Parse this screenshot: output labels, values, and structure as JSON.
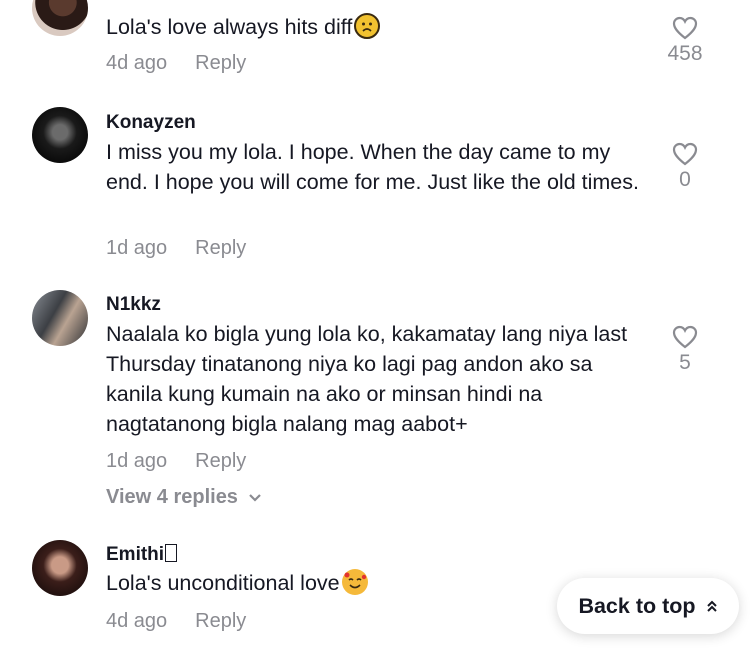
{
  "comments": [
    {
      "username": "",
      "text": "Lola's love always hits diff",
      "emoji": "sad-face-emoji",
      "time": "4d ago",
      "reply": "Reply",
      "likes": "458"
    },
    {
      "username": "Konayzen",
      "text": "I miss you my lola. I hope. When the day came to my end. I hope you will come for me. Just like the old times.",
      "time": "1d ago",
      "reply": "Reply",
      "likes": "0"
    },
    {
      "username": "N1kkz",
      "text": "Naalala ko bigla yung lola ko, kakamatay lang niya last Thursday tinatanong niya ko lagi pag andon ako sa kanila kung kumain na ako or minsan hindi na nagtatanong bigla nalang mag aabot+",
      "time": "1d ago",
      "reply": "Reply",
      "likes": "5",
      "view_replies": "View 4 replies"
    },
    {
      "username": "Emithi",
      "text": "Lola's unconditional love",
      "emoji": "smiling-face-with-hearts-emoji",
      "time": "4d ago",
      "reply": "Reply"
    }
  ],
  "back_to_top": "Back to top",
  "icons": {
    "like": "heart-outline-icon",
    "chevron": "chevron-down-icon",
    "back": "double-chevron-up-icon"
  },
  "colors": {
    "text": "#161823",
    "muted": "#8a8b91",
    "background": "#ffffff"
  }
}
